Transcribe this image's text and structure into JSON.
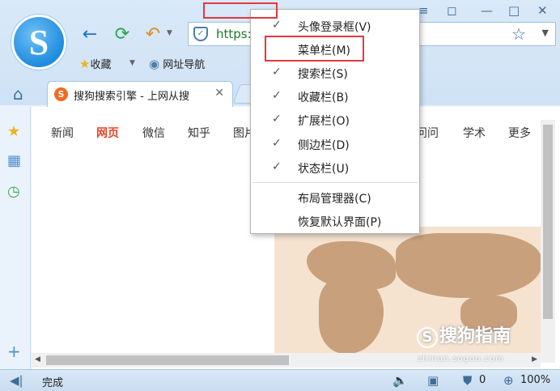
{
  "toolbar": {
    "logo_letter": "S",
    "url_text": "https:",
    "bookmarks_label": "收藏",
    "nav_label": "网址导航"
  },
  "tabs": [
    {
      "title": "搜狗搜索引擎 - 上网从搜"
    }
  ],
  "page_nav": [
    "新闻",
    "网页",
    "微信",
    "知乎",
    "图片",
    "问问",
    "学术",
    "更多"
  ],
  "page_nav_active": "网页",
  "context_menu": {
    "items": [
      {
        "label": "头像登录框(V)",
        "checked": true
      },
      {
        "label": "菜单栏(M)",
        "checked": false
      },
      {
        "label": "搜索栏(S)",
        "checked": true
      },
      {
        "label": "收藏栏(B)",
        "checked": true
      },
      {
        "label": "扩展栏(O)",
        "checked": true
      },
      {
        "label": "侧边栏(D)",
        "checked": true
      },
      {
        "label": "状态栏(U)",
        "checked": true
      }
    ],
    "extra_items": [
      {
        "label": "布局管理器(C)"
      },
      {
        "label": "恢复默认界面(P)"
      }
    ]
  },
  "status_bar": {
    "status_text": "完成",
    "block_count": "0",
    "zoom": "100%"
  },
  "watermark": {
    "brand": "搜狗指南",
    "url": "zhinan.sogou.com"
  },
  "colors": {
    "highlight": "#e0393d",
    "active_nav": "#e5452a"
  }
}
